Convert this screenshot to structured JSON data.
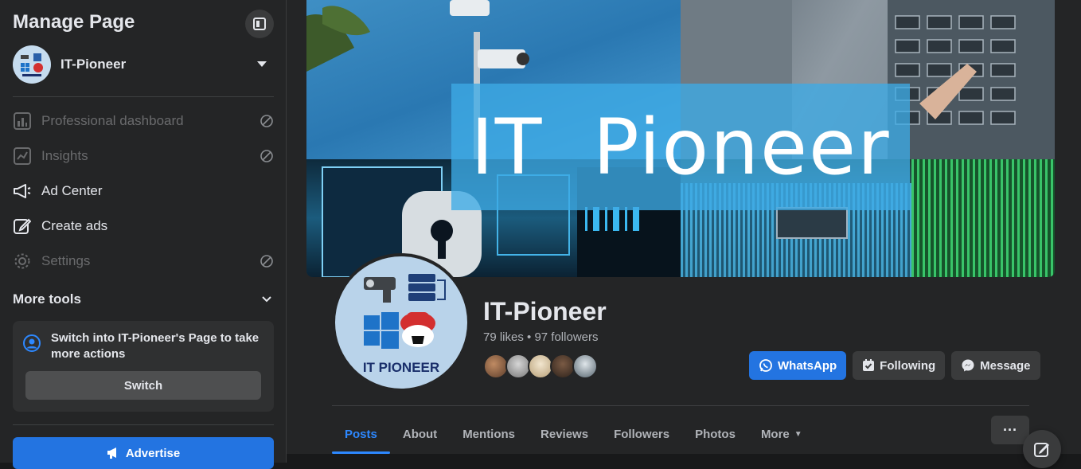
{
  "sidebar": {
    "title": "Manage Page",
    "page_name": "IT-Pioneer",
    "menu": [
      {
        "label": "Professional dashboard",
        "icon": "dashboard-icon",
        "disabled": true
      },
      {
        "label": "Insights",
        "icon": "insights-icon",
        "disabled": true
      },
      {
        "label": "Ad Center",
        "icon": "megaphone-icon",
        "disabled": false
      },
      {
        "label": "Create ads",
        "icon": "pencil-square-icon",
        "disabled": false
      },
      {
        "label": "Settings",
        "icon": "gear-icon",
        "disabled": true
      }
    ],
    "more_tools_label": "More tools",
    "switch_text": "Switch into IT-Pioneer's Page to take more actions",
    "switch_button": "Switch",
    "advertise_button": "Advertise"
  },
  "cover": {
    "banner_text": "IT  Pioneer"
  },
  "profile": {
    "picture_label": "IT PIONEER",
    "name": "IT-Pioneer",
    "stats": "79 likes • 97 followers"
  },
  "actions": {
    "whatsapp": "WhatsApp",
    "following": "Following",
    "message": "Message"
  },
  "tabs": [
    "Posts",
    "About",
    "Mentions",
    "Reviews",
    "Followers",
    "Photos",
    "More"
  ],
  "active_tab": "Posts",
  "colors": {
    "accent": "#2374e1",
    "background": "#242526",
    "text": "#e4e6eb"
  }
}
